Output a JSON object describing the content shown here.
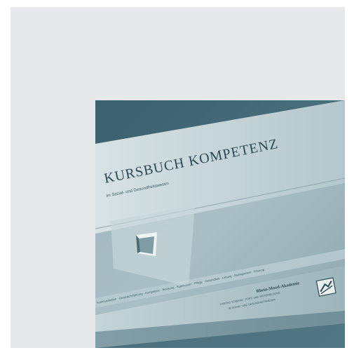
{
  "photo": {
    "cover_title": "KURSBUCH KOMPETENZ",
    "cover_subtitle": "im Sozial- und Gesundheitswesen",
    "category_strip": "Kommunikation · Gesprächsführung · Kompetenz · Beratung · Supervision · Pflege · Gesundheit · Leitung · Management · Führung",
    "publisher_name": "Rhein-Mosel-Akademie",
    "publisher_line1": "CARITAS VERBAND · FORT- UND WEITERBILDUNG",
    "publisher_line2": "IM SOZIAL- UND GESUNDHEITSWESEN",
    "colors": {
      "frame": "#e7e8e9",
      "tone_dark": "#2f4f5c",
      "tone_mid": "#7d9ba5",
      "tone_light": "#b9cbd1"
    }
  }
}
